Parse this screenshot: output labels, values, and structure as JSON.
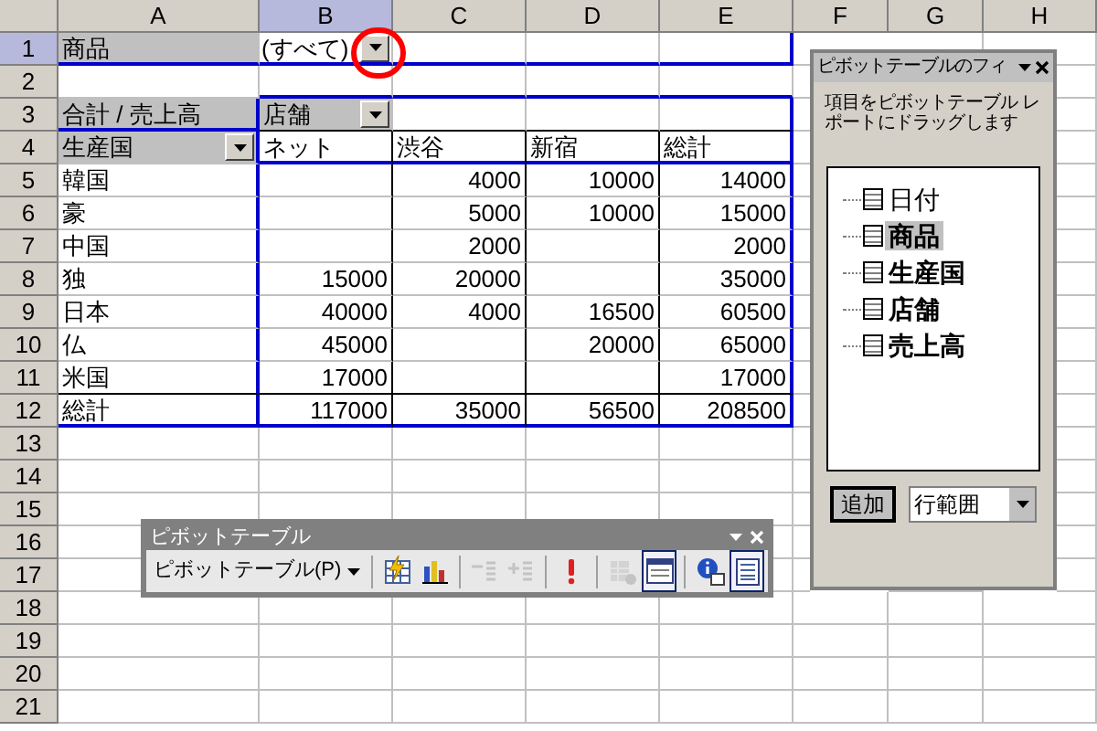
{
  "column_headers": [
    {
      "label": "A",
      "selected": false
    },
    {
      "label": "B",
      "selected": true
    },
    {
      "label": "C",
      "selected": false
    },
    {
      "label": "D",
      "selected": false
    },
    {
      "label": "E",
      "selected": false
    },
    {
      "label": "F",
      "selected": false
    },
    {
      "label": "G",
      "selected": false
    },
    {
      "label": "H",
      "selected": false
    }
  ],
  "row_headers": [
    {
      "label": "1",
      "selected": true
    },
    {
      "label": "2",
      "selected": false
    },
    {
      "label": "3",
      "selected": false
    },
    {
      "label": "4",
      "selected": false
    },
    {
      "label": "5",
      "selected": false
    },
    {
      "label": "6",
      "selected": false
    },
    {
      "label": "7",
      "selected": false
    },
    {
      "label": "8",
      "selected": false
    },
    {
      "label": "9",
      "selected": false
    },
    {
      "label": "10",
      "selected": false
    },
    {
      "label": "11",
      "selected": false
    },
    {
      "label": "12",
      "selected": false
    },
    {
      "label": "13",
      "selected": false
    },
    {
      "label": "14",
      "selected": false
    },
    {
      "label": "15",
      "selected": false
    },
    {
      "label": "16",
      "selected": false
    },
    {
      "label": "17",
      "selected": false
    },
    {
      "label": "18",
      "selected": false
    },
    {
      "label": "19",
      "selected": false
    },
    {
      "label": "20",
      "selected": false
    },
    {
      "label": "21",
      "selected": false
    }
  ],
  "page_field": {
    "label": "商品",
    "value": "(すべて)"
  },
  "data_field": "合計 / 売上高",
  "column_field": "店舗",
  "row_field": "生産国",
  "columns": [
    "ネット",
    "渋谷",
    "新宿",
    "総計"
  ],
  "rows": [
    {
      "label": "韓国",
      "values": {
        "column_2": "4000",
        "column_3": "10000",
        "column_4": "14000"
      }
    },
    {
      "label": "豪",
      "values": {
        "column_2": "5000",
        "column_3": "10000",
        "column_4": "15000"
      }
    },
    {
      "label": "中国",
      "values": {
        "column_2": "2000",
        "column_4": "2000"
      }
    },
    {
      "label": "独",
      "values": {
        "column_1": "15000",
        "column_2": "20000",
        "column_4": "35000"
      }
    },
    {
      "label": "日本",
      "values": {
        "column_1": "40000",
        "column_2": "4000",
        "column_3": "16500",
        "column_4": "60500"
      }
    },
    {
      "label": "仏",
      "values": {
        "column_1": "45000",
        "column_3": "20000",
        "column_4": "65000"
      }
    },
    {
      "label": "米国",
      "values": {
        "column_1": "17000",
        "column_4": "17000"
      }
    }
  ],
  "total": {
    "label": "総計",
    "values": {
      "column_1": "117000",
      "column_2": "35000",
      "column_3": "56500",
      "column_4": "208500"
    }
  },
  "field_list": {
    "title": "ピボットテーブルのフィ",
    "instruction": "項目をピボットテーブル レポートにドラッグします",
    "fields": [
      {
        "label": "日付",
        "bold": false,
        "selected": false
      },
      {
        "label": "商品",
        "bold": true,
        "selected": true
      },
      {
        "label": "生産国",
        "bold": true,
        "selected": false
      },
      {
        "label": "店舗",
        "bold": true,
        "selected": false
      },
      {
        "label": "売上高",
        "bold": true,
        "selected": false
      }
    ],
    "add_button": "追加",
    "area": "行範囲"
  },
  "toolbar": {
    "title": "ピボットテーブル",
    "menu": "ピボットテーブル(P)",
    "buttons": [
      {
        "kind": "format",
        "disabled": false,
        "pressed": false
      },
      {
        "kind": "chart",
        "disabled": false,
        "pressed": false
      },
      {
        "kind": "hide_detail",
        "disabled": true,
        "pressed": false
      },
      {
        "kind": "show_detail",
        "disabled": true,
        "pressed": false
      },
      {
        "kind": "refresh",
        "disabled": false,
        "pressed": false
      },
      {
        "kind": "field_settings",
        "disabled": true,
        "pressed": false
      },
      {
        "kind": "field_list",
        "disabled": false,
        "pressed": true
      },
      {
        "kind": "info",
        "disabled": false,
        "pressed": false
      },
      {
        "kind": "always_show",
        "disabled": false,
        "pressed": true
      }
    ]
  }
}
